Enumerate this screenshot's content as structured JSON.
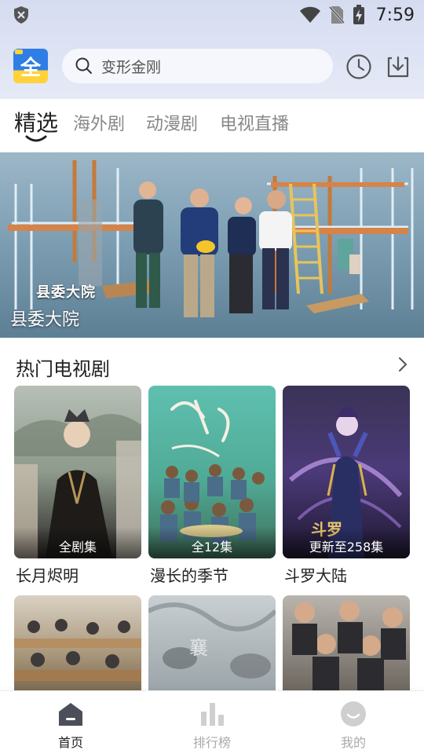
{
  "status_bar": {
    "time": "7:59",
    "icons": [
      "shield-icon",
      "wifi-icon",
      "no-sim-icon",
      "battery-charging-icon"
    ]
  },
  "app_bar": {
    "logo_glyph": "全",
    "search_placeholder": "变形金刚",
    "icons": [
      "search-icon",
      "history-clock-icon",
      "download-icon"
    ]
  },
  "tabs": [
    {
      "label": "精选",
      "active": true
    },
    {
      "label": "海外剧",
      "active": false
    },
    {
      "label": "动漫剧",
      "active": false
    },
    {
      "label": "电视直播",
      "active": false
    }
  ],
  "banner": {
    "logo_text": "县委大院",
    "title": "县委大院"
  },
  "section": {
    "title": "热门电视剧",
    "arrow_icon": "chevron-right-icon"
  },
  "cards": [
    {
      "title": "长月烬明",
      "badge": "全剧集"
    },
    {
      "title": "漫长的季节",
      "badge": "全12集"
    },
    {
      "title": "斗罗大陆",
      "badge": "更新至258集"
    }
  ],
  "bottom_nav": [
    {
      "label": "首页",
      "icon": "home-icon",
      "active": true
    },
    {
      "label": "排行榜",
      "icon": "ranking-bars-icon",
      "active": false
    },
    {
      "label": "我的",
      "icon": "profile-smile-icon",
      "active": false
    }
  ],
  "colors": {
    "header_bg": "#dfe4f5",
    "active_text": "#222222",
    "inactive_text": "#888888",
    "logo_blue": "#2f7ee6",
    "logo_yellow": "#ffd23a"
  }
}
